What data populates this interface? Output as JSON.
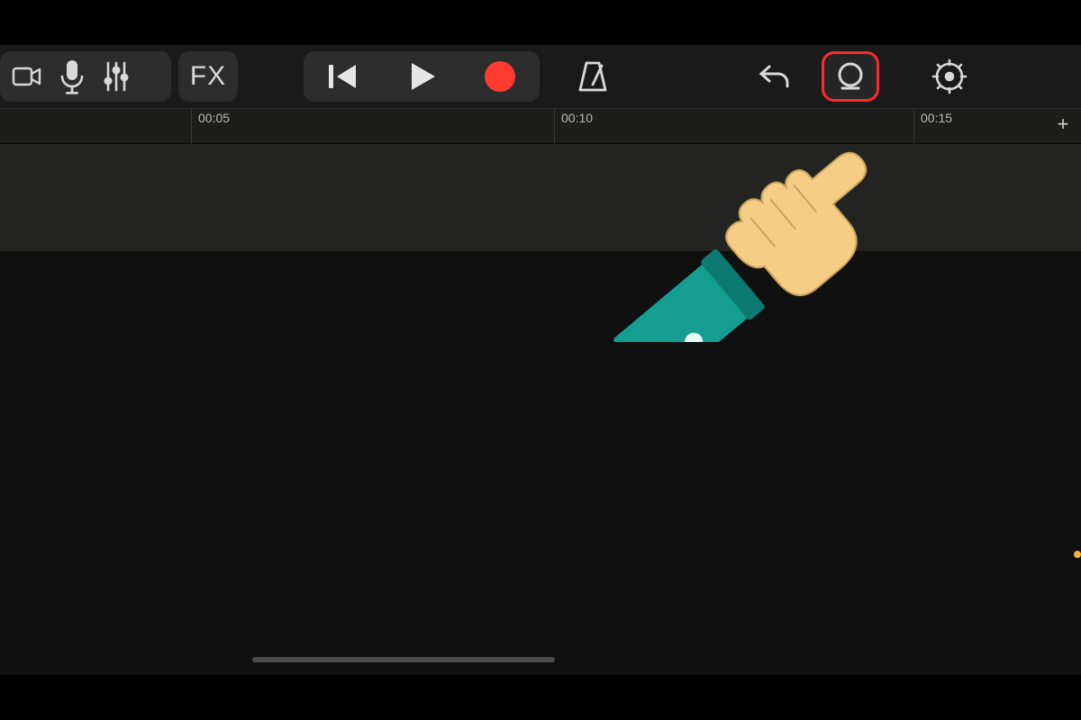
{
  "toolbar": {
    "fx_label": "FX"
  },
  "ruler": {
    "ticks": [
      {
        "pos": 212,
        "label": "00:05"
      },
      {
        "pos": 615,
        "label": "00:10"
      },
      {
        "pos": 1014,
        "label": "00:15"
      }
    ],
    "add_label": "+"
  },
  "colors": {
    "record": "#ff3b30",
    "highlight_border": "#ff2a2a"
  }
}
